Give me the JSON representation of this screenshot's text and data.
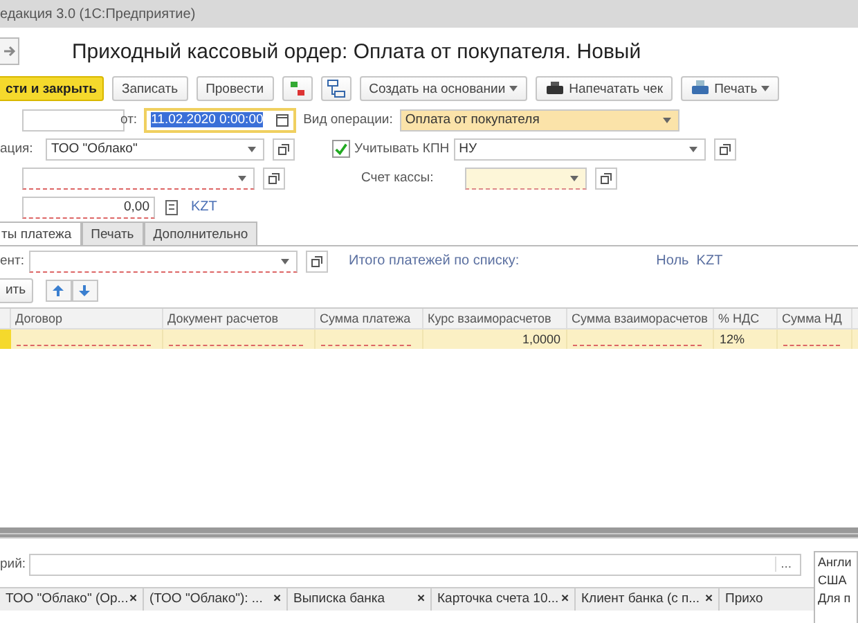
{
  "window": {
    "title": "едакция 3.0  (1С:Предприятие)"
  },
  "form": {
    "title": "Приходный кассовый ордер: Оплата от покупателя. Новый"
  },
  "toolbar": [
    {
      "label": "сти и закрыть",
      "kind": "primary"
    },
    {
      "label": "Записать",
      "kind": "plain"
    },
    {
      "label": "Провести",
      "kind": "plain"
    },
    {
      "kind": "dtkt"
    },
    {
      "kind": "struct"
    },
    {
      "label": "Создать на основании",
      "kind": "menu"
    },
    {
      "label": "Напечатать чек",
      "kind": "receipt"
    },
    {
      "label": "Печать",
      "kind": "print"
    }
  ],
  "header": {
    "date_label": "от:",
    "date": "11.02.2020  0:00:00",
    "operation_label": "Вид операции:",
    "operation": "Оплата от покупателя",
    "org_label": "ация:",
    "org": "ТОО \"Облако\"",
    "kpn_label": "Учитывать КПН",
    "kpn_checked": true,
    "kpn": "НУ",
    "cash_account_label": "Счет кассы:",
    "amount": "0,00",
    "currency": "KZT"
  },
  "tabs": [
    {
      "label": "ты платежа",
      "selected": true
    },
    {
      "label": "Печать",
      "selected": false
    },
    {
      "label": "Дополнительно",
      "selected": false
    }
  ],
  "payments": {
    "agreement_label": "ент:",
    "total_label": "Итого платежей по списку:",
    "total": "Ноль  KZT",
    "add_button": "ить",
    "columns": [
      null,
      "Договор",
      "Документ расчетов",
      "Сумма платежа",
      "Курс взаиморасчетов",
      "Сумма взаиморасчетов",
      "% НДС",
      "Сумма НД"
    ],
    "rows": [
      {
        "selected": true,
        "cells": [
          null,
          null,
          null,
          null,
          "1,0000",
          null,
          "12%",
          null
        ]
      }
    ]
  },
  "comment": {
    "label": "рий:",
    "button": "..."
  },
  "open_windows": [
    {
      "label": "ТОО \"Облако\" (Ор...",
      "close": "×"
    },
    {
      "label": "(ТОО \"Облако\"): ...",
      "close": "×"
    },
    {
      "label": "Выписка банка",
      "close": "×"
    },
    {
      "label": "Карточка счета 10...",
      "close": "×"
    },
    {
      "label": "Клиент банка (с п...",
      "close": "×"
    },
    {
      "label": "Прихо"
    }
  ],
  "language_popup": {
    "lines": [
      "Англи",
      "США",
      "Для п"
    ]
  }
}
